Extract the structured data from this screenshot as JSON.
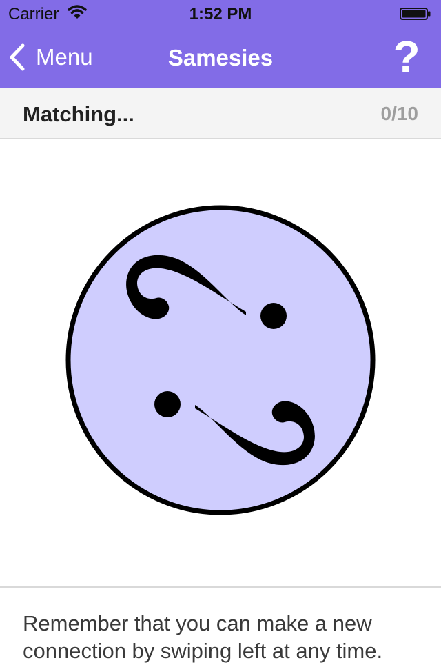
{
  "status_bar": {
    "carrier": "Carrier",
    "time": "1:52 PM",
    "wifi_icon": "wifi-icon",
    "battery_icon": "battery-icon"
  },
  "nav": {
    "back_label": "Menu",
    "back_icon": "chevron-left-icon",
    "title": "Samesies",
    "help_label": "?"
  },
  "progress": {
    "label": "Matching...",
    "count": "0/10"
  },
  "card": {
    "symbol_icon": "swirl-dots-symbol-icon"
  },
  "hint": {
    "text": "Remember that you can make a new connection by swiping left at any time."
  },
  "colors": {
    "nav_background": "#826ce7",
    "card_fill": "#cfcdfe",
    "card_border": "#000000",
    "progress_background": "#f4f4f4",
    "count_text": "#9e9e9e"
  }
}
